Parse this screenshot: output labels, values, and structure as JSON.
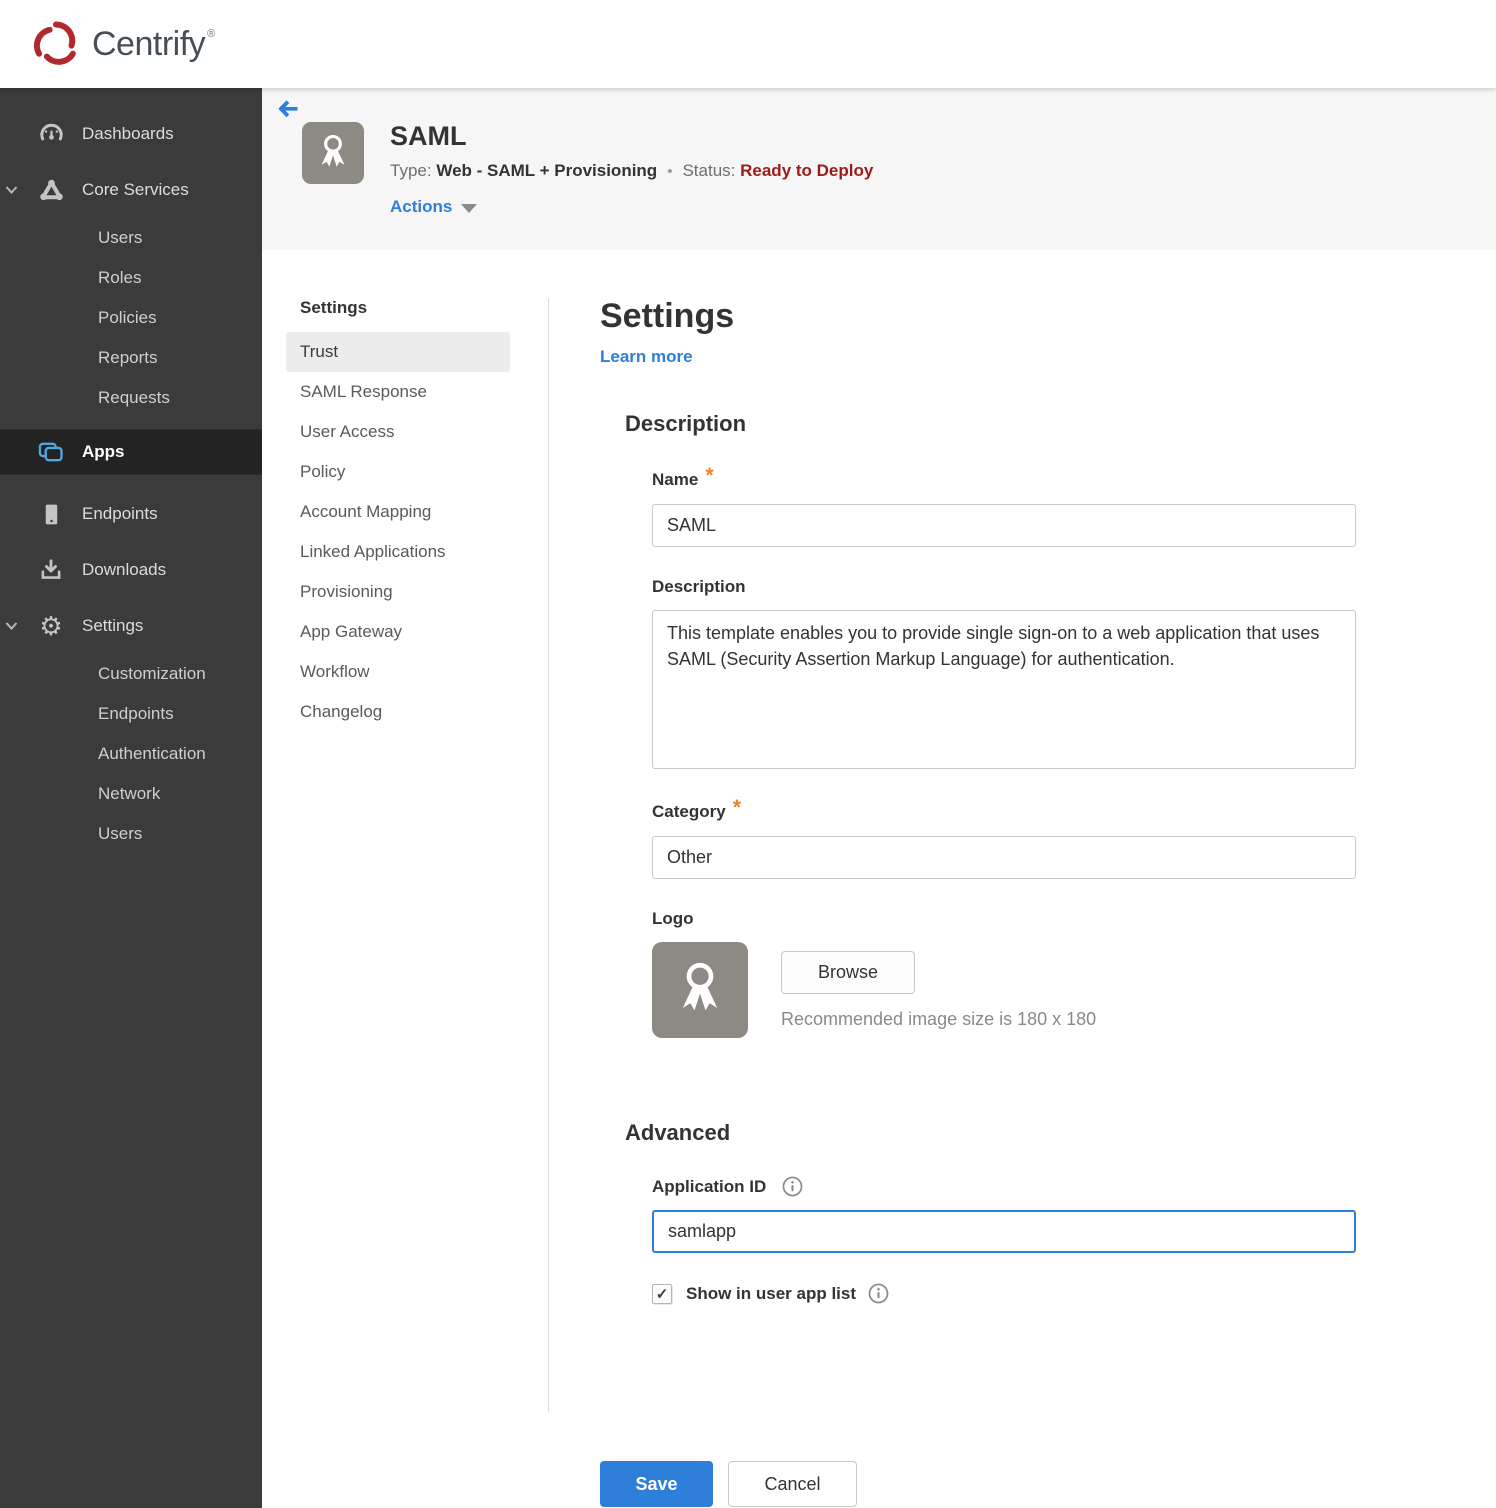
{
  "brand": {
    "name": "Centrify",
    "reg": "®"
  },
  "icons": {
    "check": "✓",
    "gear_glyph": "⚙"
  },
  "colors": {
    "brand_red": "#b3282d",
    "accent_blue": "#2e7fd9",
    "sidebar_bg": "#3b3b3b",
    "sidebar_active_bg": "#232323",
    "apps_icon_blue": "#54a8e0",
    "status_red": "#9e1b1b",
    "required_orange": "#f08224",
    "header_strip_bg": "#f6f6f6"
  },
  "sidebar": {
    "items": [
      {
        "label": "Dashboards"
      },
      {
        "label": "Core Services",
        "expanded": true,
        "children": [
          "Users",
          "Roles",
          "Policies",
          "Reports",
          "Requests"
        ]
      },
      {
        "label": "Apps",
        "active": true
      },
      {
        "label": "Endpoints"
      },
      {
        "label": "Downloads"
      },
      {
        "label": "Settings",
        "expanded": true,
        "children": [
          "Customization",
          "Endpoints",
          "Authentication",
          "Network",
          "Users"
        ]
      }
    ]
  },
  "header": {
    "title": "SAML",
    "type_label": "Type:",
    "type_value": "Web - SAML + Provisioning",
    "dot": "•",
    "status_label": "Status:",
    "status_value": "Ready to Deploy",
    "actions_label": "Actions"
  },
  "subnav": {
    "header": "Settings",
    "items": [
      {
        "label": "Trust",
        "active": true
      },
      {
        "label": "SAML Response"
      },
      {
        "label": "User Access"
      },
      {
        "label": "Policy"
      },
      {
        "label": "Account Mapping"
      },
      {
        "label": "Linked Applications"
      },
      {
        "label": "Provisioning"
      },
      {
        "label": "App Gateway"
      },
      {
        "label": "Workflow"
      },
      {
        "label": "Changelog"
      }
    ]
  },
  "form": {
    "heading": "Settings",
    "learn_more": "Learn more",
    "sections": {
      "description": "Description",
      "advanced": "Advanced"
    },
    "fields": {
      "name": {
        "label": "Name",
        "required": "*",
        "value": "SAML"
      },
      "description": {
        "label": "Description",
        "value": "This template enables you to provide single sign-on to a web application that uses SAML (Security Assertion Markup Language) for authentication."
      },
      "category": {
        "label": "Category",
        "required": "*",
        "value": "Other"
      },
      "logo": {
        "label": "Logo",
        "browse_label": "Browse",
        "hint": "Recommended image size is 180 x 180"
      },
      "application_id": {
        "label": "Application ID",
        "value": "samlapp"
      },
      "show_in_user_app_list": {
        "label": "Show in user app list",
        "checked": true
      }
    },
    "buttons": {
      "save": "Save",
      "cancel": "Cancel"
    }
  }
}
